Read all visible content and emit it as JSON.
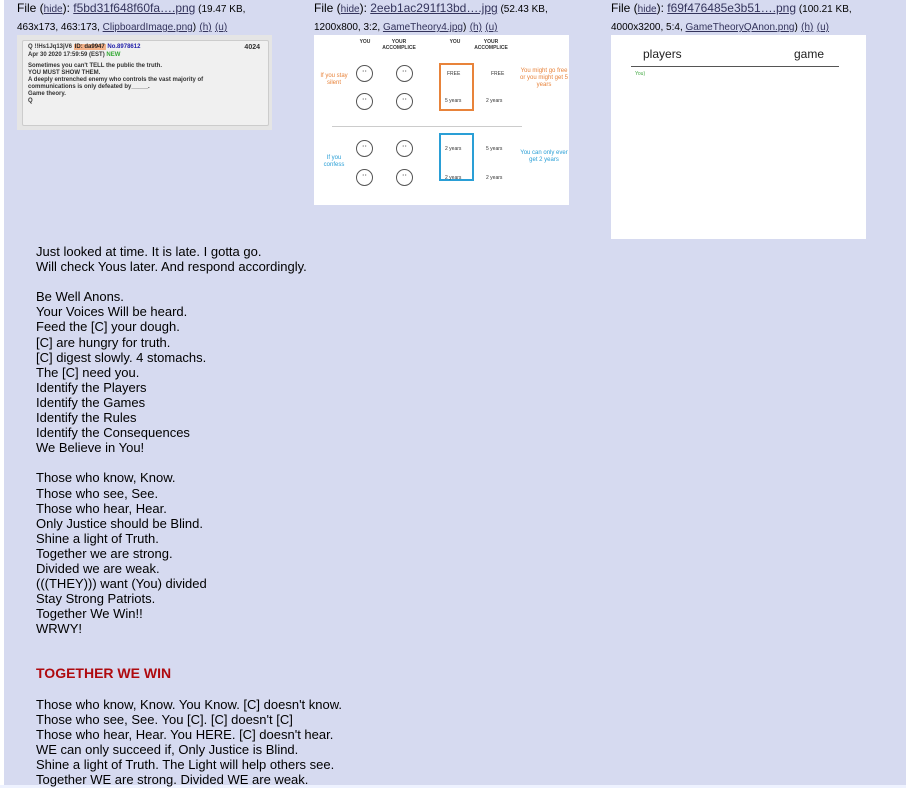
{
  "files": [
    {
      "label_prefix": "File (",
      "hide": "hide",
      "after_hide": "): ",
      "name": "f5bd31f648f60fa….png",
      "meta": " (19.47 KB, 463x173, 463:173, ",
      "orig": "ClipboardImage.png",
      "h": "(h)",
      "u": "(u)",
      "close": ")"
    },
    {
      "label_prefix": "File (",
      "hide": "hide",
      "after_hide": "): ",
      "name": "2eeb1ac291f13bd….jpg",
      "meta": " (52.43 KB, 1200x800, 3:2, ",
      "orig": "GameTheory4.jpg",
      "h": "(h)",
      "u": "(u)",
      "close": ")"
    },
    {
      "label_prefix": "File (",
      "hide": "hide",
      "after_hide": "): ",
      "name": "f69f476485e3b51….png",
      "meta": " (100.21 KB, 4000x3200, 5:4, ",
      "orig": "GameTheoryQAnon.png",
      "h": "(h)",
      "u": "(u)",
      "close": ")"
    }
  ],
  "thumb1": {
    "header": "Q !!Hs1Jq13jV6",
    "id": "ID: da9947",
    "no": "No.8978612",
    "post_num": "4024",
    "date": "Apr 30 2020 17:59:59 (EST)",
    "new": "NEW",
    "body": "Sometimes you can't TELL the public the truth.\nYOU MUST SHOW THEM.\nA deeply entrenched enemy who controls the vast majority of\ncommunications is only defeated by_____.\nGame theory.\nQ"
  },
  "thumb2": {
    "col_you": "YOU",
    "col_accomplice": "YOUR ACCOMPLICE",
    "row1": "If you stay silent",
    "row2": "If you confess",
    "free": "FREE",
    "five_years": "5 years",
    "two_years": "2 years",
    "right1": "You might go free or you might get 5 years",
    "right2": "You can only ever get 2 years"
  },
  "thumb3": {
    "players": "players",
    "game": "game",
    "you": "You)"
  },
  "message_lines": "Just looked at time. It is late. I gotta go.\nWill check Yous later. And respond accordingly.\n\nBe Well Anons.\nYour Voices Will be heard.\nFeed the [C] your dough.\n[C] are hungry for truth.\n[C] digest slowly. 4 stomachs.\nThe [C] need you.\nIdentify the Players\nIdentify the Games\nIdentify the Rules\nIdentify the Consequences\nWe Believe in You!\n\nThose who know, Know.\nThose who see, See.\nThose who hear, Hear.\nOnly Justice should be Blind.\nShine a light of Truth.\nTogether we are strong.\nDivided we are weak.\n(((THEY))) want (You) divided\nStay Strong Patriots.\nTogether We Win!!\nWRWY!",
  "heading": "TOGETHER WE WIN",
  "message2_lines": "Those who know, Know. You Know. [C] doesn't know.\nThose who see, See. You [C]. [C] doesn't [C]\nThose who hear, Hear. You HERE. [C] doesn't hear.\nWE can only succeed if, Only Justice is Blind.\nShine a light of Truth. The Light will help others see.\nTogether WE are strong. Divided WE are weak."
}
